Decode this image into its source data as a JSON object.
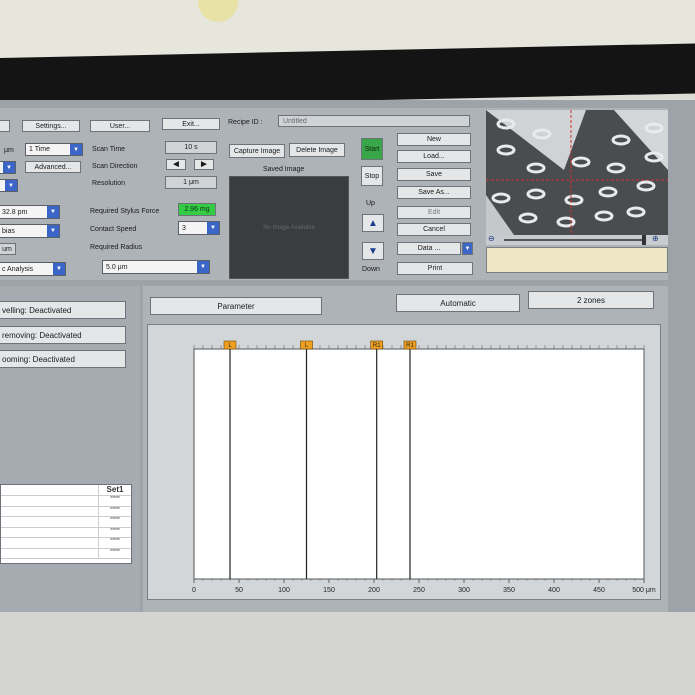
{
  "toolbar": {
    "unit_partial": "μm",
    "scan_times": "1 Time",
    "settings_label": "Settings...",
    "user_label": "User...",
    "exit_label": "Exit...",
    "recipe_id_label": "Recipe ID :",
    "recipe_id_value": "Untitled",
    "advanced_label": "Advanced...",
    "scan_time_label": "Scan Time",
    "scan_time_value": "10 s",
    "scan_direction_label": "Scan Direction",
    "resolution_label": "Resolution",
    "resolution_value": "1 μm",
    "range_value": "32.8 pm",
    "profile_partial": "bias",
    "required_force_label": "Required Stylus Force",
    "required_force_value": "2.96 mg",
    "contact_speed_label": "Contact Speed",
    "contact_speed_value": "3",
    "unit_box": "um",
    "analysis_partial": "c Analysis",
    "required_radius_label": "Required Radius",
    "radius_value": "5.0 μm"
  },
  "image": {
    "capture_label": "Capture Image",
    "delete_label": "Delete Image",
    "saved_label": "Saved Image",
    "no_image_text": "No Image Available"
  },
  "stage": {
    "start_label": "Start",
    "stop_label": "Stop",
    "up_label": "Up",
    "down_label": "Down"
  },
  "file_buttons": {
    "new": "New",
    "load": "Load...",
    "save": "Save",
    "save_as": "Save As...",
    "edit": "Edit",
    "cancel": "Cancel",
    "data": "Data ...",
    "print": "Print"
  },
  "filters": {
    "levelling": "velling: Deactivated",
    "removing": "removing: Deactivated",
    "zooming": "ooming: Deactivated"
  },
  "table": {
    "header": "Set1",
    "cells": [
      "*****",
      "*****",
      "*****",
      "*****",
      "*****",
      "*****"
    ]
  },
  "tabs": {
    "parameter": "Parameter",
    "automatic": "Automatic",
    "zones": "2 zones"
  },
  "chart_data": {
    "type": "line",
    "xlim": [
      0,
      500
    ],
    "x_unit": "μm",
    "x_ticks": [
      0,
      50,
      100,
      150,
      200,
      250,
      300,
      350,
      400,
      450,
      500
    ],
    "markers": [
      {
        "label": "L",
        "x": 40
      },
      {
        "label": "L",
        "x": 125
      },
      {
        "label": "R1",
        "x": 203
      },
      {
        "label": "R1",
        "x": 240
      }
    ],
    "grid": false
  },
  "colors": {
    "start_green": "#3aa64a",
    "force_green": "#33cc44",
    "marker_orange": "#f0a020",
    "dropdown_blue": "#3b66c8"
  }
}
